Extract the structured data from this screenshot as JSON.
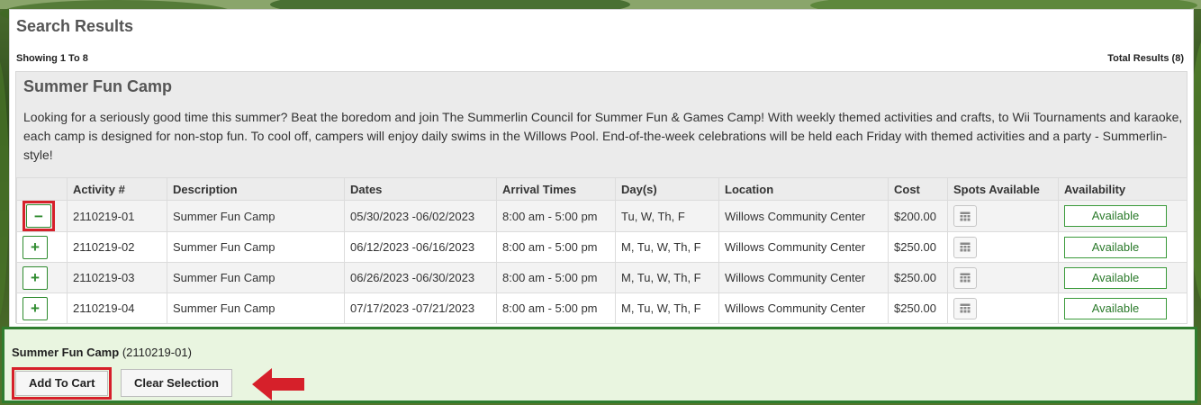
{
  "panel": {
    "title": "Search Results",
    "showing": "Showing 1 To 8",
    "total": "Total Results (8)"
  },
  "camp": {
    "title": "Summer Fun Camp",
    "description": "Looking for a seriously good time this summer? Beat the boredom and join The Summerlin Council for Summer Fun & Games Camp! With weekly themed activities and crafts, to Wii Tournaments and karaoke, each camp is designed for non-stop fun. To cool off, campers will enjoy daily swims in the Willows Pool. End-of-the-week celebrations will be held each Friday with themed activities and a party - Summerlin-style!"
  },
  "table": {
    "headers": [
      "Activity #",
      "Description",
      "Dates",
      "Arrival Times",
      "Day(s)",
      "Location",
      "Cost",
      "Spots Available",
      "Availability"
    ],
    "rows": [
      {
        "toggle": "−",
        "activity": "2110219-01",
        "description": "Summer Fun Camp",
        "dates": "05/30/2023 -06/02/2023",
        "times": "8:00 am - 5:00 pm",
        "days": "Tu, W, Th, F",
        "location": "Willows Community Center",
        "cost": "$200.00",
        "availability": "Available"
      },
      {
        "toggle": "+",
        "activity": "2110219-02",
        "description": "Summer Fun Camp",
        "dates": "06/12/2023 -06/16/2023",
        "times": "8:00 am - 5:00 pm",
        "days": "M, Tu, W, Th, F",
        "location": "Willows Community Center",
        "cost": "$250.00",
        "availability": "Available"
      },
      {
        "toggle": "+",
        "activity": "2110219-03",
        "description": "Summer Fun Camp",
        "dates": "06/26/2023 -06/30/2023",
        "times": "8:00 am - 5:00 pm",
        "days": "M, Tu, W, Th, F",
        "location": "Willows Community Center",
        "cost": "$250.00",
        "availability": "Available"
      },
      {
        "toggle": "+",
        "activity": "2110219-04",
        "description": "Summer Fun Camp",
        "dates": "07/17/2023 -07/21/2023",
        "times": "8:00 am - 5:00 pm",
        "days": "M, Tu, W, Th, F",
        "location": "Willows Community Center",
        "cost": "$250.00",
        "availability": "Available"
      }
    ]
  },
  "selection": {
    "name": "Summer Fun Camp",
    "code": "(2110219-01)",
    "add_to_cart": "Add To Cart",
    "clear": "Clear Selection"
  },
  "colors": {
    "accent_green": "#2f7d2f",
    "highlight_red": "#d6202a",
    "selection_bg": "#e9f5e0"
  },
  "icons": {
    "spots": "calendar-grid-icon",
    "arrow": "left-arrow-icon"
  }
}
